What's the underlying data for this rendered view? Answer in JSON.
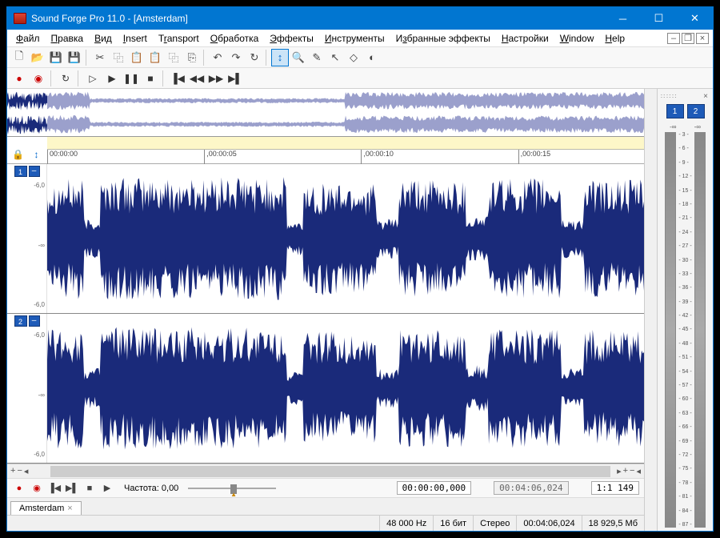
{
  "title": "Sound Forge Pro 11.0 - [Amsterdam]",
  "menu": [
    "Файл",
    "Правка",
    "Вид",
    "Insert",
    "Transport",
    "Обработка",
    "Эффекты",
    "Инструменты",
    "Избранные эффекты",
    "Настройки",
    "Window",
    "Help"
  ],
  "ruler": {
    "ticks": [
      {
        "pos": 0,
        "label": "00:00:00"
      },
      {
        "pos": 26.3,
        "label": ",00:00:05"
      },
      {
        "pos": 52.6,
        "label": ",00:00:10"
      },
      {
        "pos": 78.9,
        "label": ",00:00:15"
      }
    ]
  },
  "channels": {
    "ch1": {
      "num": "1",
      "scale": [
        "-6,0",
        "-∞",
        "-6,0"
      ]
    },
    "ch2": {
      "num": "2",
      "scale": [
        "-6,0",
        "-∞",
        "-6,0"
      ]
    }
  },
  "bottom": {
    "rate_label": "Частота:",
    "rate_value": "0,00",
    "time_current": "00:00:00,000",
    "time_total": "00:04:06,024",
    "zoom": "1:1 149"
  },
  "tab": {
    "name": "Amsterdam"
  },
  "status": {
    "sr": "48 000 Hz",
    "bits": "16 бит",
    "ch": "Стерео",
    "dur": "00:04:06,024",
    "mem": "18 929,5 Мб"
  },
  "meters": {
    "ch1": "1",
    "ch2": "2",
    "inf1": "-∞",
    "inf2": "-∞",
    "scale": [
      "- 3 -",
      "- 6 -",
      "- 9 -",
      "- 12 -",
      "- 15 -",
      "- 18 -",
      "- 21 -",
      "- 24 -",
      "- 27 -",
      "- 30 -",
      "- 33 -",
      "- 36 -",
      "- 39 -",
      "- 42 -",
      "- 45 -",
      "- 48 -",
      "- 51 -",
      "- 54 -",
      "- 57 -",
      "- 60 -",
      "- 63 -",
      "- 66 -",
      "- 69 -",
      "- 72 -",
      "- 75 -",
      "- 78 -",
      "- 81 -",
      "- 84 -",
      "- 87 -"
    ]
  }
}
